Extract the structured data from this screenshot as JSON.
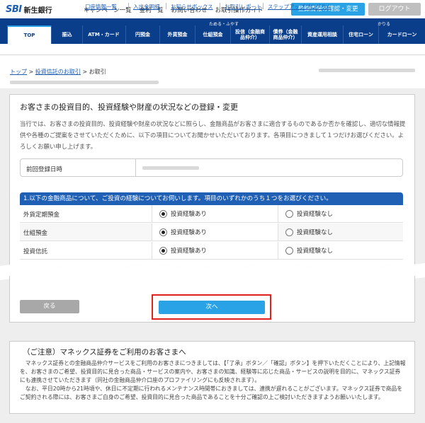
{
  "header": {
    "logo_mark": "SBI",
    "logo_text": "新生銀行",
    "links": [
      "キャンペーン一覧",
      "金利一覧",
      "お問い合わせ",
      "お取引操作ガイド"
    ],
    "register_button": "登録情報の確認・変更",
    "logout_button": "ログアウト"
  },
  "nav": {
    "group_save": "ためる・ふやす",
    "group_borrow": "かりる",
    "items": [
      "TOP",
      "振込",
      "ATM・カード",
      "円預金",
      "外貨預金",
      "仕組預金",
      "投信（金融商品仲介）",
      "債券（金融商品仲介）",
      "資産運用相談",
      "住宅ローン",
      "カードローン"
    ]
  },
  "subnav": [
    "口座情報一覧",
    "入出金明細",
    "お知らせボックス",
    "お取引レポート",
    "ステップアッププログラム"
  ],
  "breadcrumb": {
    "home": "トップ",
    "sep": ">",
    "parent": "投資信託のお取引",
    "current": "お取引"
  },
  "panel": {
    "title": "お客さまの投資目的、投資経験や財産の状況などの登録・変更",
    "description": "当行では、お客さまの投資目的、投資経験や財産の状況などに照らし、金融商品がお客さまに適合するものであるか否かを確認し、適切な情報提供や各種のご提案をさせていただくために、以下の項目についてお聞かせいただいております。各項目につきまして１つだけお選びください。よろしくお願い申し上げます。",
    "prev_label": "前回登録日時"
  },
  "question": {
    "header": "1.以下の金融商品について、ご投資の経験についてお伺いします。項目のいずれかのうち１つをお選びください。",
    "yes_label": "投資経験あり",
    "no_label": "投資経験なし",
    "rows": [
      {
        "label": "外貨定期預金",
        "selected": "yes"
      },
      {
        "label": "仕組預金",
        "selected": "yes"
      },
      {
        "label": "投資信託",
        "selected": "yes"
      }
    ]
  },
  "buttons": {
    "back": "戻る",
    "next": "次へ"
  },
  "notice": {
    "title": "（ご注意）マネックス証券をご利用のお客さまへ",
    "body1": "マネックス証券との金融商品仲介サービスをご利用のお客さまにつきましては、【「了承」ボタン／「確認」ボタン】を押下いただくことにより、上記情報を、お客さまのご希望、投資目的に見合った商品・サービスの案内や、お客さまの知識、経験等に応じた商品・サービスの説明を目的に、マネックス証券にも連携させていただきます（同社の金融商品仲介口座のプロファイリングにも反映されます）。",
    "body2": "なお、平日20時から21時頃や、休日に不定期に行われるメンテナンス時間帯におきましては、連携が遅れることがございます。マネックス証券で商品をご契約される際には、お客さまご自身のご希望、投資目的に見合った商品であることを十分ご確認の上ご検討いただきますようお願いいたします。"
  },
  "colors": {
    "brand_blue": "#0b3e8a",
    "accent": "#2aa2e6",
    "highlight": "#e0211d"
  }
}
